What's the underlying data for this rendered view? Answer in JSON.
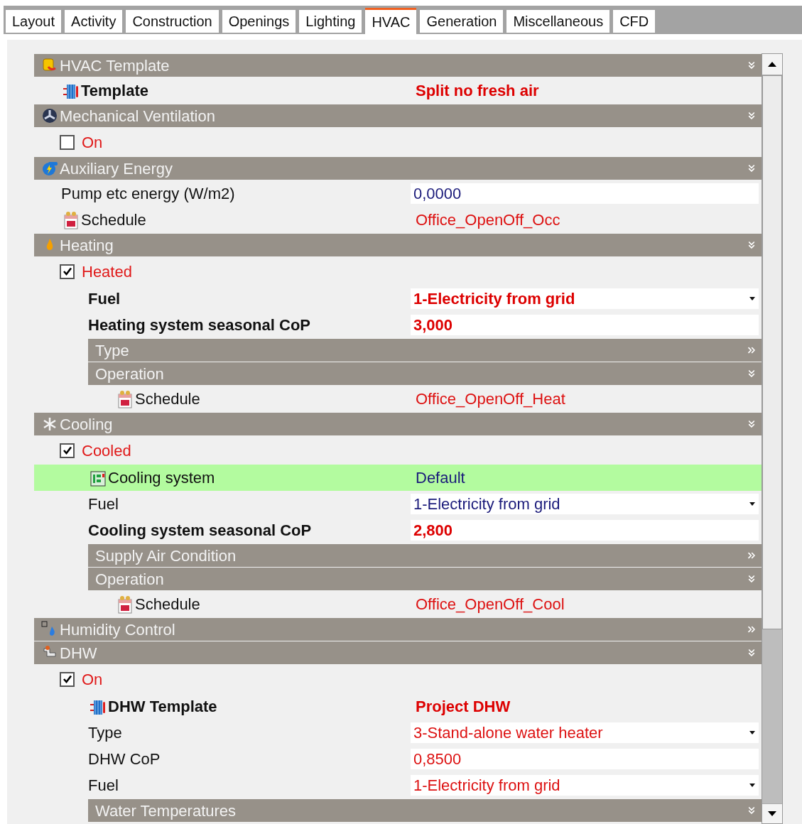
{
  "tabs": [
    {
      "label": "Layout",
      "selected": false
    },
    {
      "label": "Activity",
      "selected": false
    },
    {
      "label": "Construction",
      "selected": false
    },
    {
      "label": "Openings",
      "selected": false
    },
    {
      "label": "Lighting",
      "selected": false
    },
    {
      "label": "HVAC",
      "selected": true
    },
    {
      "label": "Generation",
      "selected": false
    },
    {
      "label": "Miscellaneous",
      "selected": false
    },
    {
      "label": "CFD",
      "selected": false
    }
  ],
  "sections": [
    {
      "kind": "section",
      "title": "HVAC Template",
      "expanded": true,
      "children": [
        {
          "kind": "template",
          "label": "Template",
          "label_bold": true,
          "value": "Split no fresh air",
          "value_bold": true,
          "color": "#dd0000",
          "boxed": false,
          "dropdown": false,
          "highlighted": false
        }
      ]
    },
    {
      "kind": "section",
      "title": "Mechanical Ventilation",
      "expanded": true,
      "children": [
        {
          "kind": "checkbox",
          "label": "On",
          "checked": false
        }
      ]
    },
    {
      "kind": "section",
      "title": "Auxiliary Energy",
      "expanded": true,
      "children": [
        {
          "kind": "property",
          "label": "Pump etc energy (W/m2)",
          "label_bold": false,
          "value": "0,0000",
          "value_bold": false,
          "color": "#1a1a7a",
          "boxed": true,
          "dropdown": false,
          "highlighted": false
        },
        {
          "kind": "schedule",
          "label": "Schedule",
          "label_bold": false,
          "value": "Office_OpenOff_Occ",
          "value_bold": false,
          "color": "#dd1111",
          "boxed": false,
          "dropdown": false,
          "highlighted": false
        }
      ]
    },
    {
      "kind": "section",
      "title": "Heating",
      "expanded": true,
      "children": [
        {
          "kind": "checkbox",
          "label": "Heated",
          "checked": true,
          "children": [
            {
              "kind": "property",
              "label": "Fuel",
              "label_bold": true,
              "value": "1-Electricity from grid",
              "value_bold": true,
              "color": "#dd0000",
              "boxed": true,
              "dropdown": true,
              "highlighted": false
            },
            {
              "kind": "property",
              "label": "Heating system seasonal CoP",
              "label_bold": true,
              "value": "3,000",
              "value_bold": true,
              "color": "#dd0000",
              "boxed": true,
              "dropdown": false,
              "highlighted": false
            },
            {
              "kind": "section",
              "title": "Type",
              "expanded": false
            },
            {
              "kind": "section",
              "title": "Operation",
              "expanded": true,
              "children": [
                {
                  "kind": "schedule",
                  "label": "Schedule",
                  "label_bold": false,
                  "value": "Office_OpenOff_Heat",
                  "value_bold": false,
                  "color": "#dd1111",
                  "boxed": false,
                  "dropdown": false,
                  "highlighted": false
                }
              ]
            }
          ]
        }
      ]
    },
    {
      "kind": "section",
      "title": "Cooling",
      "expanded": true,
      "children": [
        {
          "kind": "checkbox",
          "label": "Cooled",
          "checked": true,
          "children": [
            {
              "kind": "system",
              "label": "Cooling system",
              "label_bold": false,
              "value": "Default",
              "value_bold": false,
              "color": "#1a1a7a",
              "boxed": false,
              "dropdown": false,
              "highlighted": true
            },
            {
              "kind": "property",
              "label": "Fuel",
              "label_bold": false,
              "value": "1-Electricity from grid",
              "value_bold": false,
              "color": "#1a1a7a",
              "boxed": true,
              "dropdown": true,
              "highlighted": false
            },
            {
              "kind": "property",
              "label": "Cooling system seasonal CoP",
              "label_bold": true,
              "value": "2,800",
              "value_bold": true,
              "color": "#dd0000",
              "boxed": true,
              "dropdown": false,
              "highlighted": false
            },
            {
              "kind": "section",
              "title": "Supply Air Condition",
              "expanded": false
            },
            {
              "kind": "section",
              "title": "Operation",
              "expanded": true,
              "children": [
                {
                  "kind": "schedule",
                  "label": "Schedule",
                  "label_bold": false,
                  "value": "Office_OpenOff_Cool",
                  "value_bold": false,
                  "color": "#dd1111",
                  "boxed": false,
                  "dropdown": false,
                  "highlighted": false
                }
              ]
            }
          ]
        }
      ]
    },
    {
      "kind": "section",
      "title": "Humidity Control",
      "expanded": false
    },
    {
      "kind": "section",
      "title": "DHW",
      "expanded": true,
      "children": [
        {
          "kind": "checkbox",
          "label": "On",
          "checked": true,
          "children": [
            {
              "kind": "template",
              "label": "DHW Template",
              "label_bold": true,
              "value": "Project DHW",
              "value_bold": true,
              "color": "#dd0000",
              "boxed": false,
              "dropdown": false,
              "highlighted": false
            },
            {
              "kind": "property",
              "label": "Type",
              "label_bold": false,
              "value": "3-Stand-alone water heater",
              "value_bold": false,
              "color": "#dd1111",
              "boxed": true,
              "dropdown": true,
              "highlighted": false
            },
            {
              "kind": "property",
              "label": "DHW CoP",
              "label_bold": false,
              "value": "0,8500",
              "value_bold": false,
              "color": "#dd1111",
              "boxed": true,
              "dropdown": false,
              "highlighted": false
            },
            {
              "kind": "property",
              "label": "Fuel",
              "label_bold": false,
              "value": "1-Electricity from grid",
              "value_bold": false,
              "color": "#dd1111",
              "boxed": true,
              "dropdown": true,
              "highlighted": false
            },
            {
              "kind": "section",
              "title": "Water Temperatures",
              "expanded": true
            }
          ]
        }
      ]
    }
  ]
}
